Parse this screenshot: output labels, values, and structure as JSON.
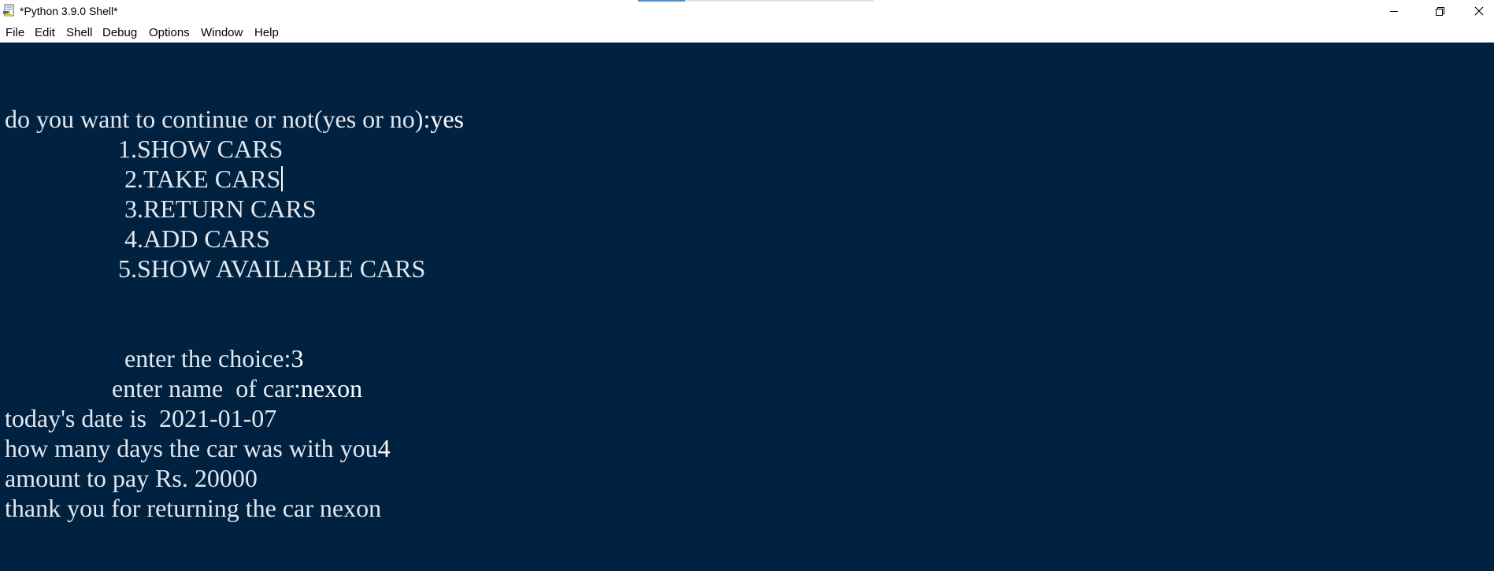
{
  "window": {
    "title": "*Python 3.9.0 Shell*"
  },
  "menu": {
    "items": [
      "File",
      "Edit",
      "Shell",
      "Debug",
      "Options",
      "Window",
      "Help"
    ]
  },
  "icons": {
    "app": "python-idle-icon",
    "minimize": "minimize-icon",
    "maximize": "restore-icon",
    "close": "close-icon"
  },
  "colors": {
    "shell_background": "#002240",
    "shell_text": "#e2e6ee",
    "user_input": "#ffffff"
  },
  "shell": {
    "continue_prompt": "do you want to continue or not(yes or no):",
    "continue_answer": "yes",
    "menu_options": [
      "1.SHOW CARS",
      "2.TAKE CARS",
      "3.RETURN CARS",
      "4.ADD CARS",
      "5.SHOW AVAILABLE CARS"
    ],
    "choice_prompt": "enter the choice:",
    "choice_answer": "3",
    "car_name_prompt": "enter name  of car:",
    "car_name_answer": "nexon",
    "date_line": "today's date is  2021-01-07",
    "days_prompt": "how many days the car was with you",
    "days_answer": "4",
    "amount_line": "amount to pay Rs. 20000",
    "thanks_line": "thank you for returning the car nexon"
  }
}
